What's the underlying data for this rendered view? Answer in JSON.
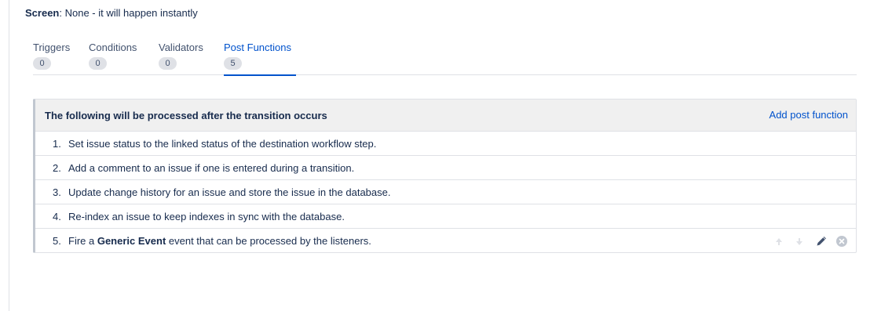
{
  "screen": {
    "label": "Screen",
    "separator": ":",
    "value": " None - it will happen instantly"
  },
  "tabs": [
    {
      "label": "Triggers",
      "count": "0",
      "active": false
    },
    {
      "label": "Conditions",
      "count": "0",
      "active": false
    },
    {
      "label": "Validators",
      "count": "0",
      "active": false
    },
    {
      "label": "Post Functions",
      "count": "5",
      "active": true
    }
  ],
  "panel": {
    "title": "The following will be processed after the transition occurs",
    "add_link": "Add post function"
  },
  "post_functions": [
    {
      "num": "1.",
      "text": "Set issue status to the linked status of the destination workflow step."
    },
    {
      "num": "2.",
      "text": "Add a comment to an issue if one is entered during a transition."
    },
    {
      "num": "3.",
      "text": "Update change history for an issue and store the issue in the database."
    },
    {
      "num": "4.",
      "text": "Re-index an issue to keep indexes in sync with the database."
    },
    {
      "num": "5.",
      "text_before": "Fire a ",
      "text_bold": "Generic Event",
      "text_after": " event that can be processed by the listeners."
    }
  ],
  "row_actions": {
    "icons": [
      "arrow-up-icon",
      "arrow-down-icon",
      "pencil-icon",
      "delete-icon"
    ],
    "colors": {
      "arrows": "#dfe1e6",
      "pencil": "#42526e",
      "delete": "#c1c7d0"
    }
  },
  "colors": {
    "link": "#0052cc",
    "text": "#172b4d",
    "header_bg": "#f0f0f0",
    "border": "#dfe1e6"
  }
}
